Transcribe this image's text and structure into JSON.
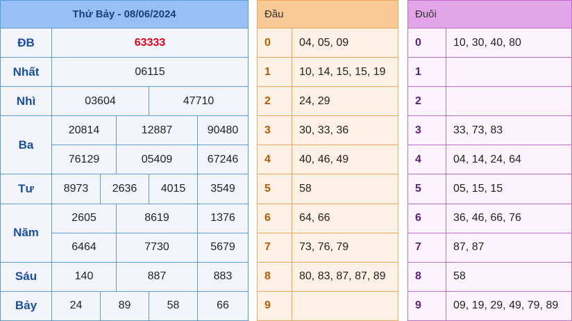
{
  "results": {
    "title": "Thứ Bảy - 08/06/2024",
    "db": {
      "label": "ĐB",
      "values": [
        "63333"
      ]
    },
    "nhat": {
      "label": "Nhất",
      "values": [
        "06115"
      ]
    },
    "nhi": {
      "label": "Nhì",
      "values": [
        "03604",
        "47710"
      ]
    },
    "ba": {
      "label": "Ba",
      "values": [
        "20814",
        "12887",
        "90480",
        "76129",
        "05409",
        "67246"
      ]
    },
    "tu": {
      "label": "Tư",
      "values": [
        "8973",
        "2636",
        "4015",
        "3549"
      ]
    },
    "nam": {
      "label": "Năm",
      "values": [
        "2605",
        "8619",
        "1376",
        "6464",
        "7730",
        "5679"
      ]
    },
    "sau": {
      "label": "Sáu",
      "values": [
        "140",
        "887",
        "883"
      ]
    },
    "bay": {
      "label": "Bảy",
      "values": [
        "24",
        "89",
        "58",
        "66"
      ]
    },
    "special_color": "#e0001a",
    "header_color": "#99bff7"
  },
  "dau": {
    "title": "Đầu",
    "rows": [
      {
        "key": "0",
        "values": "04, 05, 09"
      },
      {
        "key": "1",
        "values": "10, 14, 15, 15, 19"
      },
      {
        "key": "2",
        "values": "24, 29"
      },
      {
        "key": "3",
        "values": "30, 33, 36"
      },
      {
        "key": "4",
        "values": "40, 46, 49"
      },
      {
        "key": "5",
        "values": "58"
      },
      {
        "key": "6",
        "values": "64, 66"
      },
      {
        "key": "7",
        "values": "73, 76, 79"
      },
      {
        "key": "8",
        "values": "80, 83, 87, 87, 89"
      },
      {
        "key": "9",
        "values": ""
      }
    ],
    "header_color": "#f9c998"
  },
  "duoi": {
    "title": "Đuôi",
    "rows": [
      {
        "key": "0",
        "values": "10, 30, 40, 80"
      },
      {
        "key": "1",
        "values": ""
      },
      {
        "key": "2",
        "values": ""
      },
      {
        "key": "3",
        "values": "33, 73, 83"
      },
      {
        "key": "4",
        "values": "04, 14, 24, 64"
      },
      {
        "key": "5",
        "values": "05, 15, 15"
      },
      {
        "key": "6",
        "values": "36, 46, 66, 76"
      },
      {
        "key": "7",
        "values": "87, 87"
      },
      {
        "key": "8",
        "values": "58"
      },
      {
        "key": "9",
        "values": "09, 19, 29, 49, 79, 89"
      }
    ],
    "header_color": "#e2a6e8"
  }
}
